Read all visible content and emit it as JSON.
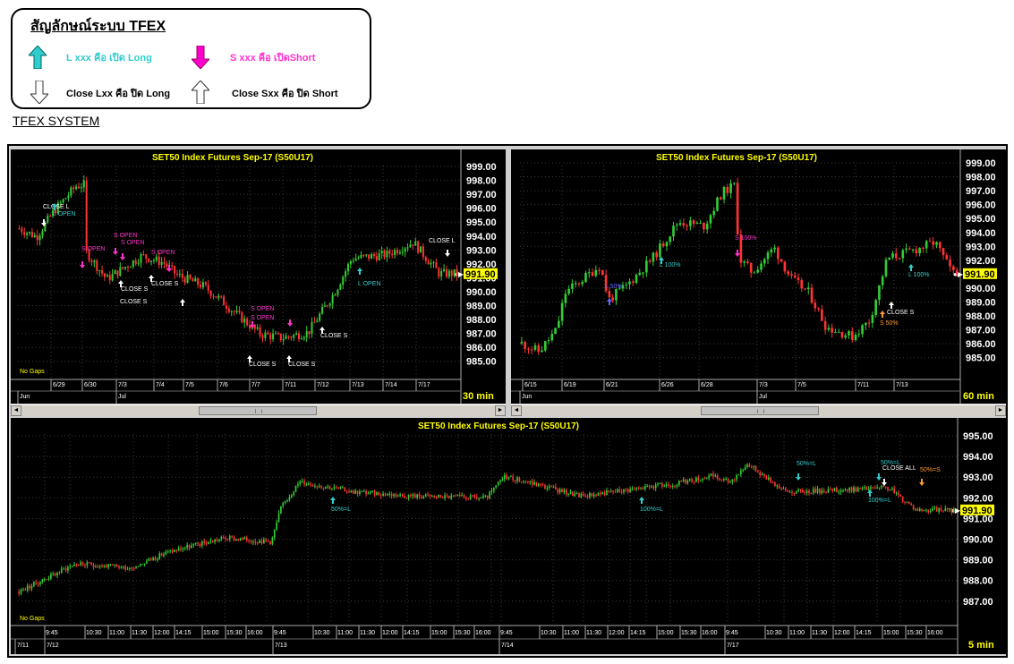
{
  "legend": {
    "title": "สัญลักษณ์ระบบ TFEX",
    "long_open": "L xxx คือ เปิด Long",
    "short_open": "S xxx คือ เปิดShort",
    "long_close": "Close Lxx คือ ปิด Long",
    "short_close": "Close Sxx คือ ปิด Short",
    "colors": {
      "long": "#33cccc",
      "short": "#ff33cc"
    }
  },
  "system_title": "TFEX SYSTEM",
  "charts": [
    {
      "id": "chart-30min",
      "title": "SET50  Index  Futures  Sep-17  (S50U17)",
      "timeframe": "30  min",
      "no_gaps": "No Gaps",
      "price_label": "991.90",
      "y_ticks": [
        "999.00",
        "998.00",
        "997.00",
        "996.00",
        "995.00",
        "994.00",
        "993.00",
        "992.00",
        "991.00",
        "990.00",
        "989.00",
        "988.00",
        "987.00",
        "986.00",
        "985.00"
      ],
      "y_range": [
        984.3,
        999.8
      ],
      "x_dates": [
        "6/29",
        "6/30",
        "7/3",
        "7/4",
        "7/5",
        "7/6",
        "7/7",
        "7/11",
        "7/12",
        "7/13",
        "7/14",
        "7/17"
      ],
      "x_months": [
        "Jun",
        "Jul"
      ],
      "annotations": [
        {
          "text": "CLOSE  L",
          "color": "#ffffff"
        },
        {
          "text": "L  OPEN",
          "color": "#33cccc"
        },
        {
          "text": "S  OPEN",
          "color": "#ff33cc"
        },
        {
          "text": "S  OPEN",
          "color": "#ff33cc"
        },
        {
          "text": "S  OPEN",
          "color": "#ff33cc"
        },
        {
          "text": "S  OPEN",
          "color": "#ff33cc"
        },
        {
          "text": "CLOSE  S",
          "color": "#ffffff"
        },
        {
          "text": "CLOSE  S",
          "color": "#ffffff"
        },
        {
          "text": "CLOSE  S",
          "color": "#ffffff"
        },
        {
          "text": "S  OPEN",
          "color": "#ff33cc"
        },
        {
          "text": "S  OPEN",
          "color": "#ff33cc"
        },
        {
          "text": "CLOSE  S",
          "color": "#ffffff"
        },
        {
          "text": "CLOSE  S",
          "color": "#ffffff"
        },
        {
          "text": "CLOSE  S",
          "color": "#ffffff"
        },
        {
          "text": "L  OPEN",
          "color": "#33cccc"
        },
        {
          "text": "CLOSE  L",
          "color": "#ffffff"
        }
      ]
    },
    {
      "id": "chart-60min",
      "title": "SET50  Index  Futures  Sep-17  (S50U17)",
      "timeframe": "60  min",
      "no_gaps": "",
      "price_label": "991.90",
      "y_ticks": [
        "999.00",
        "998.00",
        "997.00",
        "996.00",
        "995.00",
        "994.00",
        "993.00",
        "992.00",
        "991.00",
        "990.00",
        "989.00",
        "988.00",
        "987.00",
        "986.00",
        "985.00"
      ],
      "y_range": [
        984.3,
        999.8
      ],
      "x_dates": [
        "6/15",
        "6/19",
        "6/21",
        "6/26",
        "6/28",
        "7/3",
        "7/5",
        "7/11",
        "7/13"
      ],
      "x_months": [
        "Jun",
        "Jul"
      ],
      "annotations": [
        {
          "text": "L  100%",
          "color": "#33cccc"
        },
        {
          "text": "L  50%",
          "color": "#6666ff"
        },
        {
          "text": "S  100%",
          "color": "#ff33cc"
        },
        {
          "text": "CLOSE  S",
          "color": "#ffffff"
        },
        {
          "text": "S  50%",
          "color": "#ff9933"
        },
        {
          "text": "L  100%",
          "color": "#33cccc"
        }
      ]
    },
    {
      "id": "chart-5min",
      "title": "SET50  Index  Futures  Sep-17  (S50U17)",
      "timeframe": "5  min",
      "no_gaps": "No Gaps",
      "price_label": "991.90",
      "y_ticks": [
        "995.00",
        "994.00",
        "993.00",
        "992.00",
        "991.00",
        "990.00",
        "989.00",
        "988.00",
        "987.00"
      ],
      "y_range": [
        986.2,
        995.7
      ],
      "x_times": [
        "9:45",
        "10:30",
        "11:00",
        "11:30",
        "12:00",
        "14:15",
        "15:00",
        "15:30",
        "16:00"
      ],
      "x_days": [
        "7/11",
        "7/12",
        "7/13",
        "7/14",
        "7/17"
      ],
      "annotations": [
        {
          "text": "50%=L",
          "color": "#33cccc"
        },
        {
          "text": "100%=L",
          "color": "#33cccc"
        },
        {
          "text": "50%=L",
          "color": "#33cccc"
        },
        {
          "text": "50%=L",
          "color": "#33cccc"
        },
        {
          "text": "CLOSE  ALL",
          "color": "#ffffff"
        },
        {
          "text": "50%=S",
          "color": "#ff9933"
        },
        {
          "text": "100%=L",
          "color": "#33cccc"
        }
      ]
    }
  ],
  "scroll": {
    "left": "◄",
    "right": "►"
  }
}
